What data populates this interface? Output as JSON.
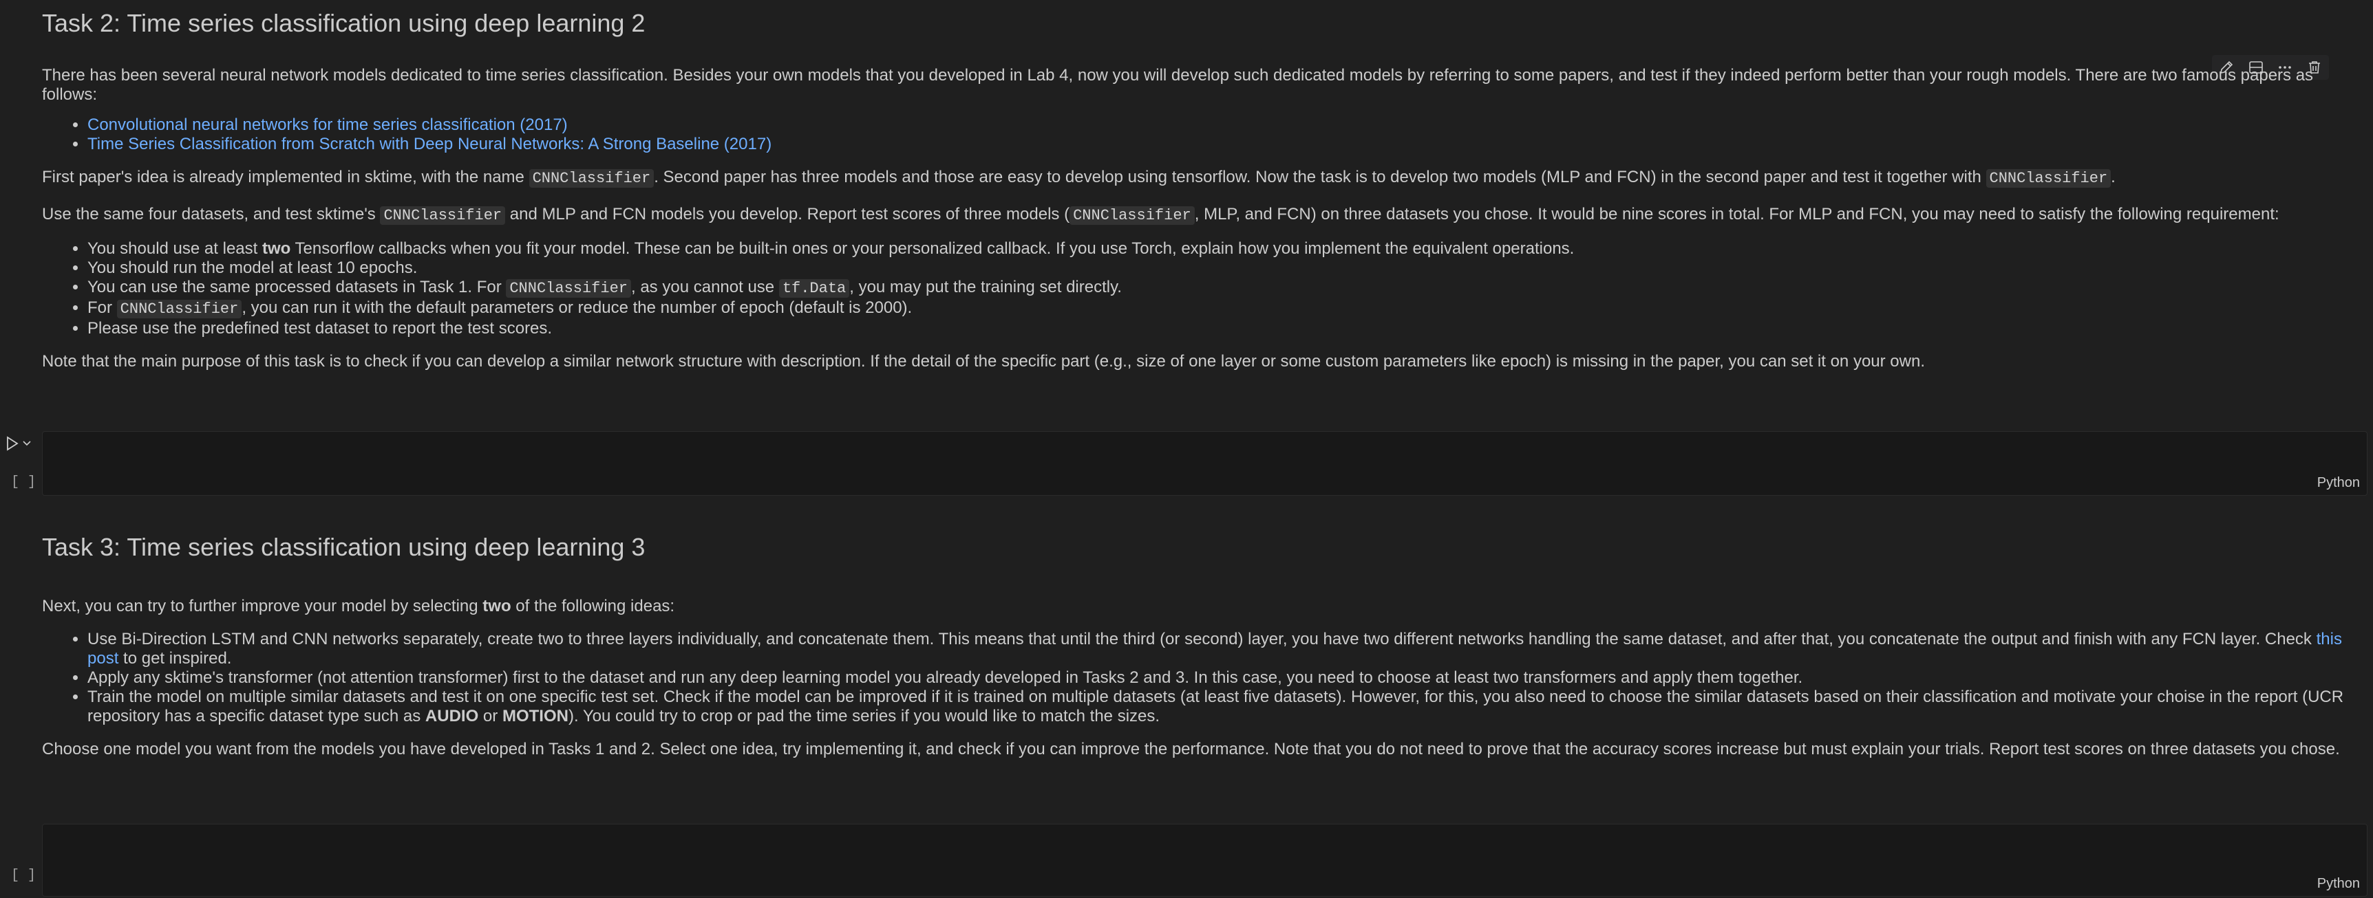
{
  "task2": {
    "heading": "Task 2: Time series classification using deep learning 2",
    "intro": "There has been several neural network models dedicated to time series classification. Besides your own models that you developed in Lab 4, now you will develop such dedicated models by referring to some papers, and test if they indeed perform better than your rough models. There are two famous papers as follows:",
    "links": [
      "Convolutional neural networks for time series classification (2017)",
      "Time Series Classification from Scratch with Deep Neural Networks: A Strong Baseline (2017)"
    ],
    "p2": {
      "a": "First paper's idea is already implemented in sktime, with the name ",
      "code1": "CNNClassifier",
      "b": ". Second paper has three models and those are easy to develop using tensorflow. Now the task is to develop two models (MLP and FCN) in the second paper and test it together with ",
      "code2": "CNNClassifier",
      "c": "."
    },
    "p3": {
      "a": "Use the same four datasets, and test sktime's ",
      "code1": "CNNClassifier",
      "b": " and MLP and FCN models you develop. Report test scores of three models (",
      "code2": "CNNClassifier",
      "c": ", MLP, and FCN) on three datasets you chose. It would be nine scores in total. For MLP and FCN, you may need to satisfy the following requirement:"
    },
    "reqs": {
      "r1a": "You should use at least ",
      "r1bold": "two",
      "r1b": " Tensorflow callbacks when you fit your model. These can be built-in ones or your personalized callback. If you use Torch, explain how you implement the equivalent operations.",
      "r2": "You should run the model at least 10 epochs.",
      "r3a": "You can use the same processed datasets in Task 1. For ",
      "r3code1": "CNNClassifier",
      "r3b": ", as you cannot use ",
      "r3code2": "tf.Data",
      "r3c": ", you may put the training set directly.",
      "r4a": "For ",
      "r4code": "CNNClassifier",
      "r4b": ", you can run it with the default parameters or reduce the number of epoch (default is 2000).",
      "r5": "Please use the predefined test dataset to report the test scores."
    },
    "note": "Note that the main purpose of this task is to check if you can develop a similar network structure with description. If the detail of the specific part (e.g., size of one layer or some custom parameters like epoch) is missing in the paper, you can set it on your own."
  },
  "cell1": {
    "exec": "[ ]",
    "lang": "Python"
  },
  "task3": {
    "heading": "Task 3: Time series classification using deep learning 3",
    "intro_a": "Next, you can try to further improve your model by selecting ",
    "intro_bold": "two",
    "intro_b": " of the following ideas:",
    "i1a": "Use Bi-Direction LSTM and CNN networks separately, create two to three layers individually, and concatenate them. This means that until the third (or second) layer, you have two different networks handling the same dataset, and after that, you concatenate the output and finish with any FCN layer. Check ",
    "i1link": "this post",
    "i1b": " to get inspired.",
    "i2": "Apply any sktime's transformer (not attention transformer) first to the dataset and run any deep learning model you already developed in Tasks 2 and 3. In this case, you need to choose at least two transformers and apply them together.",
    "i3a": "Train the model on multiple similar datasets and test it on one specific test set. Check if the model can be improved if it is trained on multiple datasets (at least five datasets). However, for this, you also need to choose the similar datasets based on their classification and motivate your choise in the report (UCR repository has a specific dataset type such as ",
    "i3bold1": "AUDIO",
    "i3mid": " or ",
    "i3bold2": "MOTION",
    "i3b": "). You could try to crop or pad the time series if you would like to match the sizes.",
    "closing": "Choose one model you want from the models you have developed in Tasks 1 and 2. Select one idea, try implementing it, and check if you can improve the performance. Note that you do not need to prove that the accuracy scores increase but must explain your trials. Report test scores on three datasets you chose."
  },
  "cell2": {
    "exec": "[ ]",
    "lang": "Python"
  },
  "toolbar_icons": [
    "edit-icon",
    "split-cell-icon",
    "more-icon",
    "delete-icon"
  ],
  "colors": {
    "background": "#1f1f1f",
    "text": "#cccccc",
    "link": "#6eaeff",
    "code_bg": "#323232"
  }
}
